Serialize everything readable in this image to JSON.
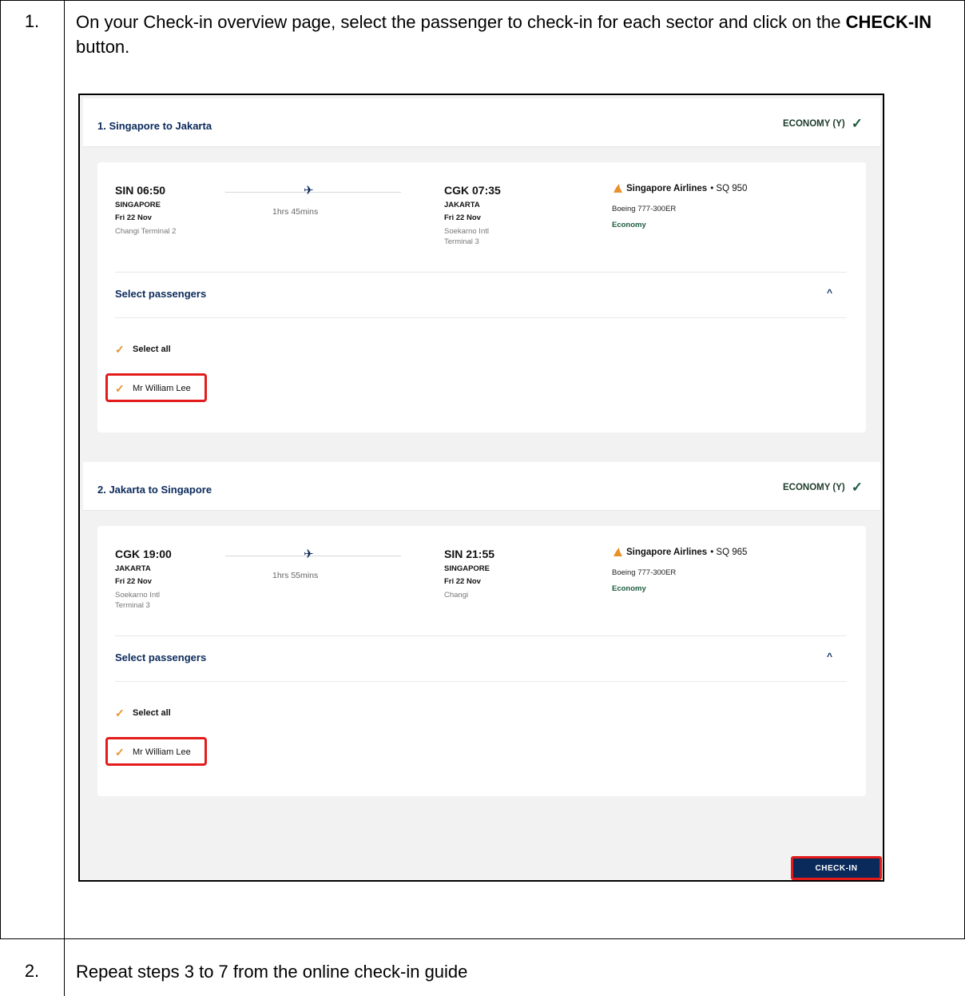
{
  "steps": [
    {
      "number": "1.",
      "text_before": "On your Check-in overview page, select the passenger to check-in for each sector and click on the ",
      "text_bold": "CHECK-IN",
      "text_after": " button."
    },
    {
      "number": "2.",
      "text": "Repeat steps 3 to 7 from the online check-in guide"
    }
  ],
  "sectors": [
    {
      "title": "1. Singapore to Jakarta",
      "cabin": "ECONOMY (Y)",
      "departure": {
        "code_time": "SIN 06:50",
        "city": "SINGAPORE",
        "date": "Fri 22 Nov",
        "terminal_line1": "Changi Terminal 2",
        "terminal_line2": ""
      },
      "duration": "1hrs 45mins",
      "arrival": {
        "code_time": "CGK 07:35",
        "city": "JAKARTA",
        "date": "Fri 22 Nov",
        "terminal_line1": "Soekarno Intl",
        "terminal_line2": "Terminal 3"
      },
      "airline": "Singapore Airlines",
      "flight": "• SQ 950",
      "aircraft": "Boeing 777-300ER",
      "cabin_class": "Economy",
      "select_passengers": "Select passengers",
      "select_all": "Select all",
      "passenger": "Mr William Lee"
    },
    {
      "title": "2. Jakarta to Singapore",
      "cabin": "ECONOMY (Y)",
      "departure": {
        "code_time": "CGK 19:00",
        "city": "JAKARTA",
        "date": "Fri 22 Nov",
        "terminal_line1": "Soekarno Intl",
        "terminal_line2": "Terminal 3"
      },
      "duration": "1hrs 55mins",
      "arrival": {
        "code_time": "SIN 21:55",
        "city": "SINGAPORE",
        "date": "Fri 22 Nov",
        "terminal_line1": "Changi",
        "terminal_line2": ""
      },
      "airline": "Singapore Airlines",
      "flight": "• SQ 965",
      "aircraft": "Boeing 777-300ER",
      "cabin_class": "Economy",
      "select_passengers": "Select passengers",
      "select_all": "Select all",
      "passenger": "Mr William Lee"
    }
  ],
  "checkin_button": "CHECK-IN",
  "colors": {
    "navy": "#0b2a5c",
    "highlight": "#e31b1b",
    "checkbox": "#e8912a",
    "green": "#1d5c3f"
  }
}
